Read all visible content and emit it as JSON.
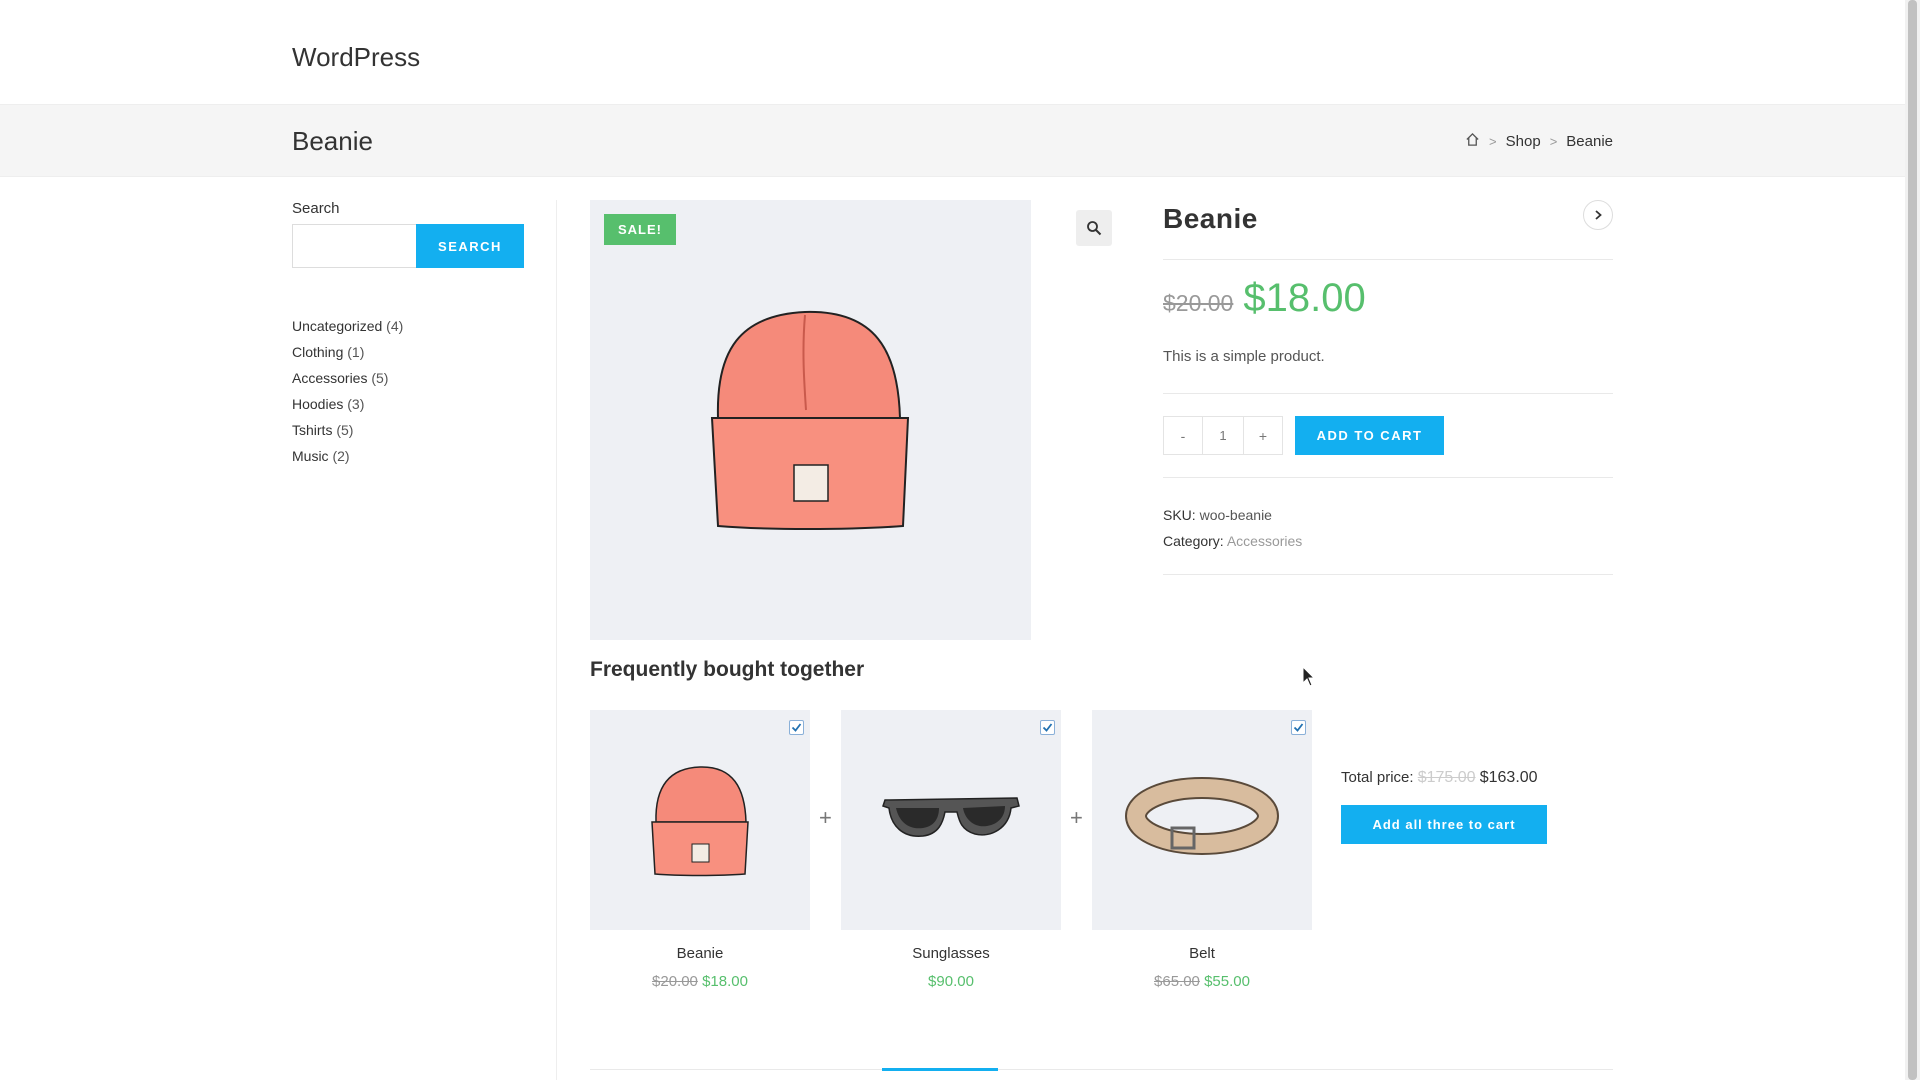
{
  "site": {
    "title": "WordPress"
  },
  "page": {
    "title": "Beanie"
  },
  "breadcrumb": {
    "home_icon": "home-icon",
    "items": [
      "Shop",
      "Beanie"
    ],
    "separator": ">"
  },
  "sidebar": {
    "search_label": "Search",
    "search_value": "",
    "search_button": "SEARCH",
    "categories": [
      {
        "name": "Uncategorized",
        "count": "(4)"
      },
      {
        "name": "Clothing",
        "count": "(1)"
      },
      {
        "name": "Accessories",
        "count": "(5)"
      },
      {
        "name": "Hoodies",
        "count": "(3)"
      },
      {
        "name": "Tshirts",
        "count": "(5)"
      },
      {
        "name": "Music",
        "count": "(2)"
      }
    ]
  },
  "product": {
    "sale_badge": "SALE!",
    "title": "Beanie",
    "price_old": "$20.00",
    "price_new": "$18.00",
    "short_description": "This is a simple product.",
    "qty_minus": "-",
    "qty_value": "1",
    "qty_plus": "+",
    "add_to_cart": "ADD TO CART",
    "sku_label": "SKU:",
    "sku_value": "woo-beanie",
    "category_label": "Category:",
    "category_value": "Accessories",
    "image_icon": "beanie-image"
  },
  "fbt": {
    "heading": "Frequently bought together",
    "items": [
      {
        "name": "Beanie",
        "price_old": "$20.00",
        "price_new": "$18.00",
        "image": "beanie-image"
      },
      {
        "name": "Sunglasses",
        "price_old": "",
        "price_new": "$90.00",
        "image": "sunglasses-image"
      },
      {
        "name": "Belt",
        "price_old": "$65.00",
        "price_new": "$55.00",
        "image": "belt-image"
      }
    ],
    "plus": "+",
    "total_label": "Total price:",
    "total_old": "$175.00",
    "total_new": "$163.00",
    "add_all": "Add all three to cart"
  },
  "colors": {
    "accent": "#13aff0",
    "sale": "#57bf6d",
    "image_bg": "#eef0f4"
  }
}
